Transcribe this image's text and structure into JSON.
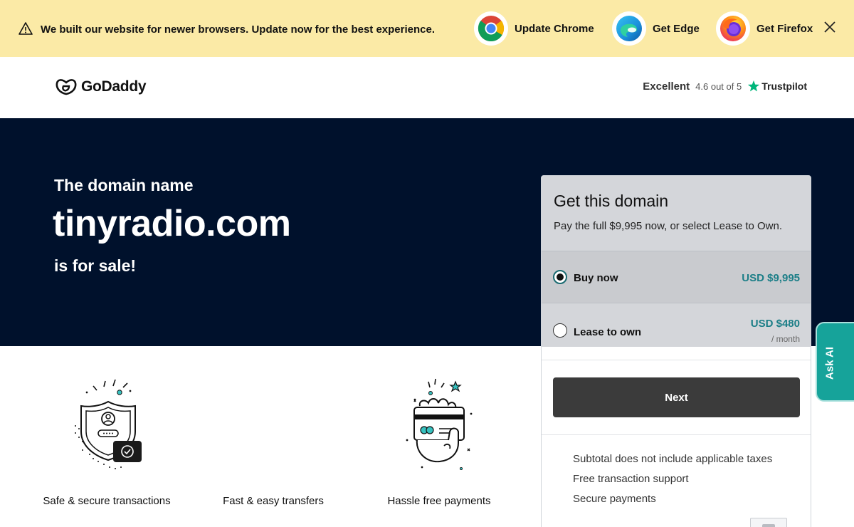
{
  "banner": {
    "message": "We built our website for newer browsers. Update now for the best experience.",
    "browsers": [
      {
        "label": "Update Chrome",
        "icon": "chrome-logo-icon"
      },
      {
        "label": "Get Edge",
        "icon": "edge-logo-icon"
      },
      {
        "label": "Get Firefox",
        "icon": "firefox-logo-icon"
      }
    ],
    "close_icon": "close-icon",
    "bg_color": "#fbeaa6"
  },
  "header": {
    "brand": "GoDaddy",
    "rating": {
      "label": "Excellent",
      "score": "4.6 out of 5",
      "provider": "Trustpilot",
      "star_color": "#00b67a"
    }
  },
  "hero": {
    "pre": "The domain name",
    "domain": "tinyradio.com",
    "post": "is for sale!",
    "bg_color": "#00112c"
  },
  "features": [
    {
      "label": "Safe & secure transactions",
      "icon": "shield-icon"
    },
    {
      "label": "Fast & easy transfers",
      "icon": "transfer-icon"
    },
    {
      "label": "Hassle free payments",
      "icon": "payment-card-icon"
    }
  ],
  "card": {
    "title": "Get this domain",
    "subtitle": "Pay the full $9,995 now, or select Lease to Own.",
    "options": [
      {
        "label": "Buy now",
        "price": "USD $9,995",
        "selected": true
      },
      {
        "label": "Lease to own",
        "price": "USD $480",
        "period": "/ month",
        "selected": false
      }
    ],
    "next_label": "Next",
    "bullets": [
      "Subtotal does not include applicable taxes",
      "Free transaction support",
      "Secure payments"
    ],
    "accent_color": "#1b7e87"
  },
  "ask_ai": {
    "label": "Ask AI",
    "color": "#16a39a"
  }
}
